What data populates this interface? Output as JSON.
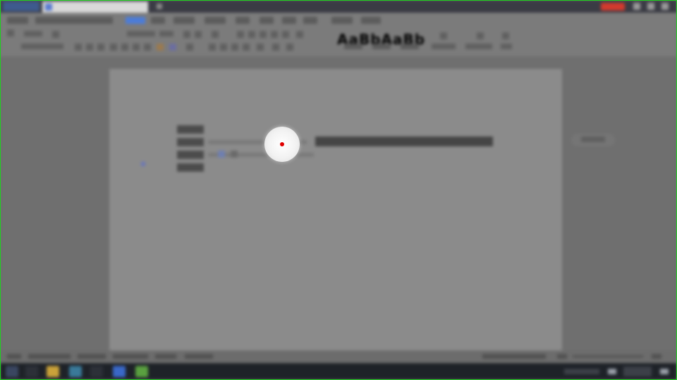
{
  "colors": {
    "accent": "#4c7cd8",
    "login": "#d23a2e",
    "click_dot": "#e00000",
    "frame": "#1fd01f"
  },
  "ribbon": {
    "style_sample": "AaBbAaBb",
    "active_tab_index": 6
  },
  "cursor": {
    "icon": "click-indicator-icon"
  }
}
